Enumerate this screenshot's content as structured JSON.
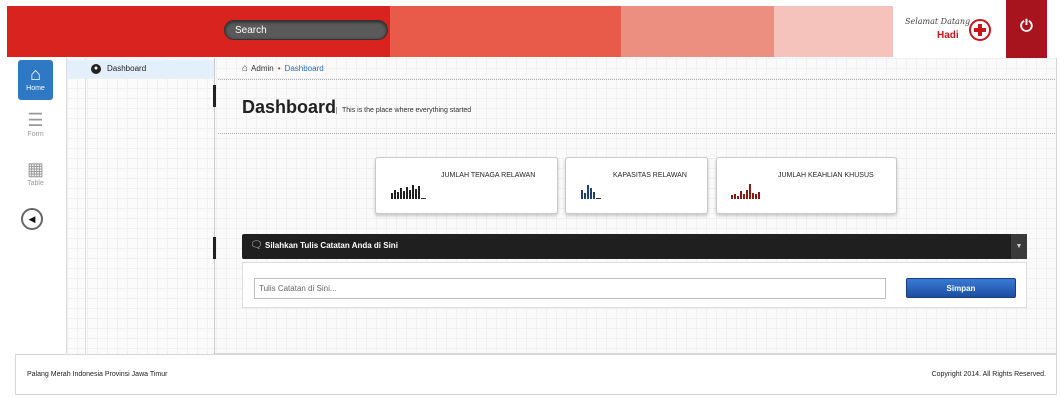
{
  "header": {
    "search_placeholder": "Search",
    "welcome_label": "Selamat Datang",
    "user_name": "Hadi",
    "segment_colors": [
      "#d8231f",
      "#e85a4a",
      "#ec8e80",
      "#f5c3bc"
    ]
  },
  "sidebar": {
    "items": [
      {
        "label": "Home",
        "icon": "home-icon"
      },
      {
        "label": "Form",
        "icon": "list-icon"
      },
      {
        "label": "Table",
        "icon": "table-icon"
      }
    ],
    "menu": [
      {
        "label": "Dashboard"
      }
    ]
  },
  "breadcrumb": {
    "root": "Admin",
    "current": "Dashboard"
  },
  "page": {
    "title": "Dashboard",
    "subtitle": "This is the place where everything started"
  },
  "cards": [
    {
      "label": "JUMLAH TENAGA RELAWAN",
      "icon": "bar-chart-icon",
      "color": "#1f1f1f"
    },
    {
      "label": "KAPASITAS RELAWAN",
      "icon": "bar-chart-icon",
      "color": "#1f3f73"
    },
    {
      "label": "JUMLAH KEAHLIAN KHUSUS",
      "icon": "bar-chart-icon",
      "color": "#8b1a14"
    }
  ],
  "notes": {
    "title": "Silahkan Tulis Catatan Anda di Sini",
    "placeholder": "Tulis Catatan di Sini...",
    "save_label": "Simpan"
  },
  "footer": {
    "left": "Palang Merah Indonesia Provinsi Jawa Timur",
    "right": "Copyright 2014. All Rights Reserved."
  }
}
